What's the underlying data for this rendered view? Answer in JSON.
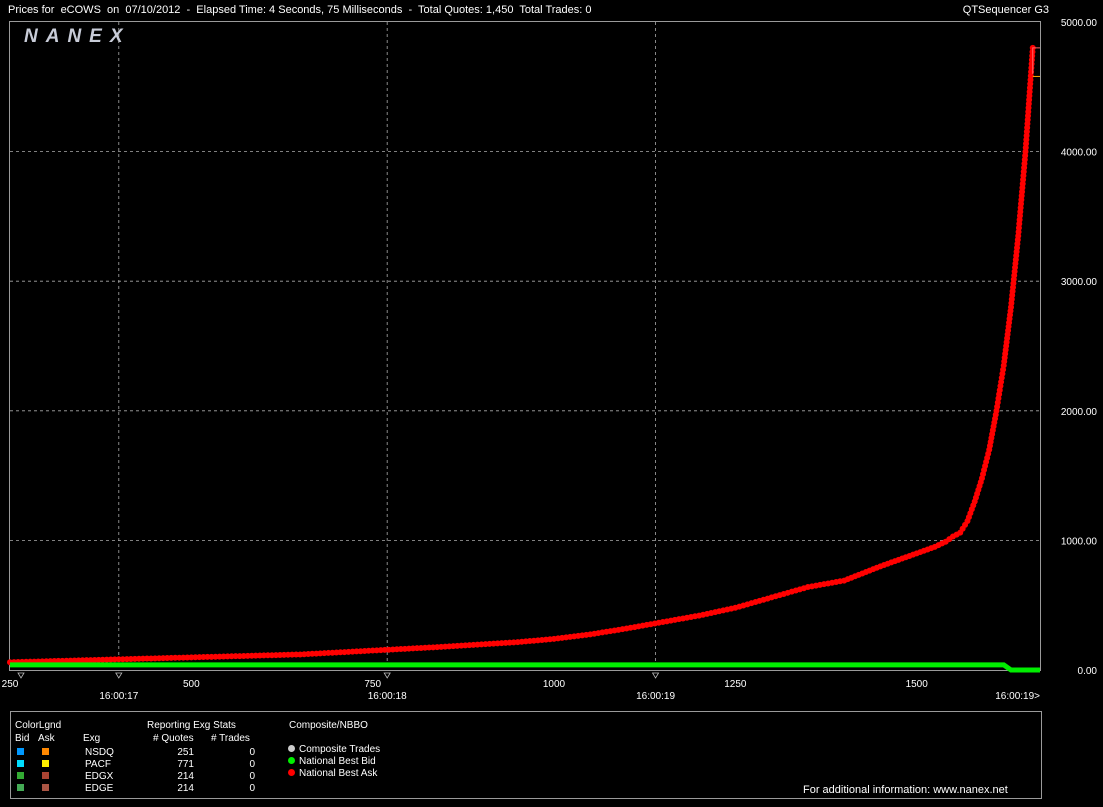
{
  "header": {
    "title": "Prices for  eCOWS  on  07/10/2012  -  Elapsed Time: 4 Seconds, 75 Milliseconds  -  Total Quotes: 1,450  Total Trades: 0",
    "app_name": "QTSequencer G3",
    "logo": "NANEX"
  },
  "chart_data": {
    "type": "line",
    "y_ticks": [
      "5000.00",
      "4000.00",
      "3000.00",
      "2000.00",
      "1000.00",
      "0.00"
    ],
    "ylim": [
      0,
      5000
    ],
    "xlim": [
      250,
      1670
    ],
    "x_ticks": [
      "250",
      "500",
      "750",
      "1000",
      "1250",
      "1500"
    ],
    "time_ticks": [
      {
        "label": "16:00:17",
        "x": 400
      },
      {
        "label": "16:00:18",
        "x": 770
      },
      {
        "label": "16:00:19",
        "x": 1140
      },
      {
        "label": "16:00:19>",
        "x": 1395
      }
    ],
    "grid": true,
    "series": [
      {
        "name": "National Best Ask",
        "color": "#ff0000",
        "x": [
          250,
          350,
          450,
          550,
          650,
          750,
          850,
          950,
          1000,
          1050,
          1100,
          1150,
          1200,
          1250,
          1300,
          1350,
          1400,
          1450,
          1500,
          1525,
          1540,
          1550,
          1560,
          1570,
          1580,
          1590,
          1600,
          1610,
          1620,
          1630,
          1640,
          1650,
          1660
        ],
        "y": [
          60,
          75,
          90,
          105,
          120,
          150,
          180,
          215,
          240,
          275,
          320,
          370,
          420,
          480,
          560,
          640,
          690,
          800,
          900,
          950,
          990,
          1030,
          1060,
          1150,
          1300,
          1480,
          1700,
          2000,
          2350,
          2800,
          3350,
          4000,
          4800
        ]
      },
      {
        "name": "National Best Bid",
        "color": "#00ee00",
        "x": [
          250,
          1620,
          1630,
          1670
        ],
        "y": [
          40,
          40,
          0,
          0
        ]
      }
    ]
  },
  "legend": {
    "color_legend_title": "ColorLgnd",
    "bid_header": "Bid",
    "ask_header": "Ask",
    "exg_header": "Exg",
    "stats_title": "Reporting Exg Stats",
    "quotes_header": "# Quotes",
    "trades_header": "# Trades",
    "composite_title": "Composite/NBBO",
    "exchanges": [
      {
        "name": "NSDQ",
        "quotes": "251",
        "trades": "0",
        "bid_color": "#0099ff",
        "ask_color": "#ff8800"
      },
      {
        "name": "PACF",
        "quotes": "771",
        "trades": "0",
        "bid_color": "#00ddff",
        "ask_color": "#ffee00"
      },
      {
        "name": "EDGX",
        "quotes": "214",
        "trades": "0",
        "bid_color": "#33aa33",
        "ask_color": "#aa4433"
      },
      {
        "name": "EDGE",
        "quotes": "214",
        "trades": "0",
        "bid_color": "#44aa55",
        "ask_color": "#aa5544"
      }
    ],
    "composite": [
      {
        "label": "Composite Trades",
        "color": "#cccccc"
      },
      {
        "label": "National Best Bid",
        "color": "#00ee00"
      },
      {
        "label": "National Best Ask",
        "color": "#ff0000"
      }
    ],
    "footer": "For additional information: www.nanex.net"
  }
}
